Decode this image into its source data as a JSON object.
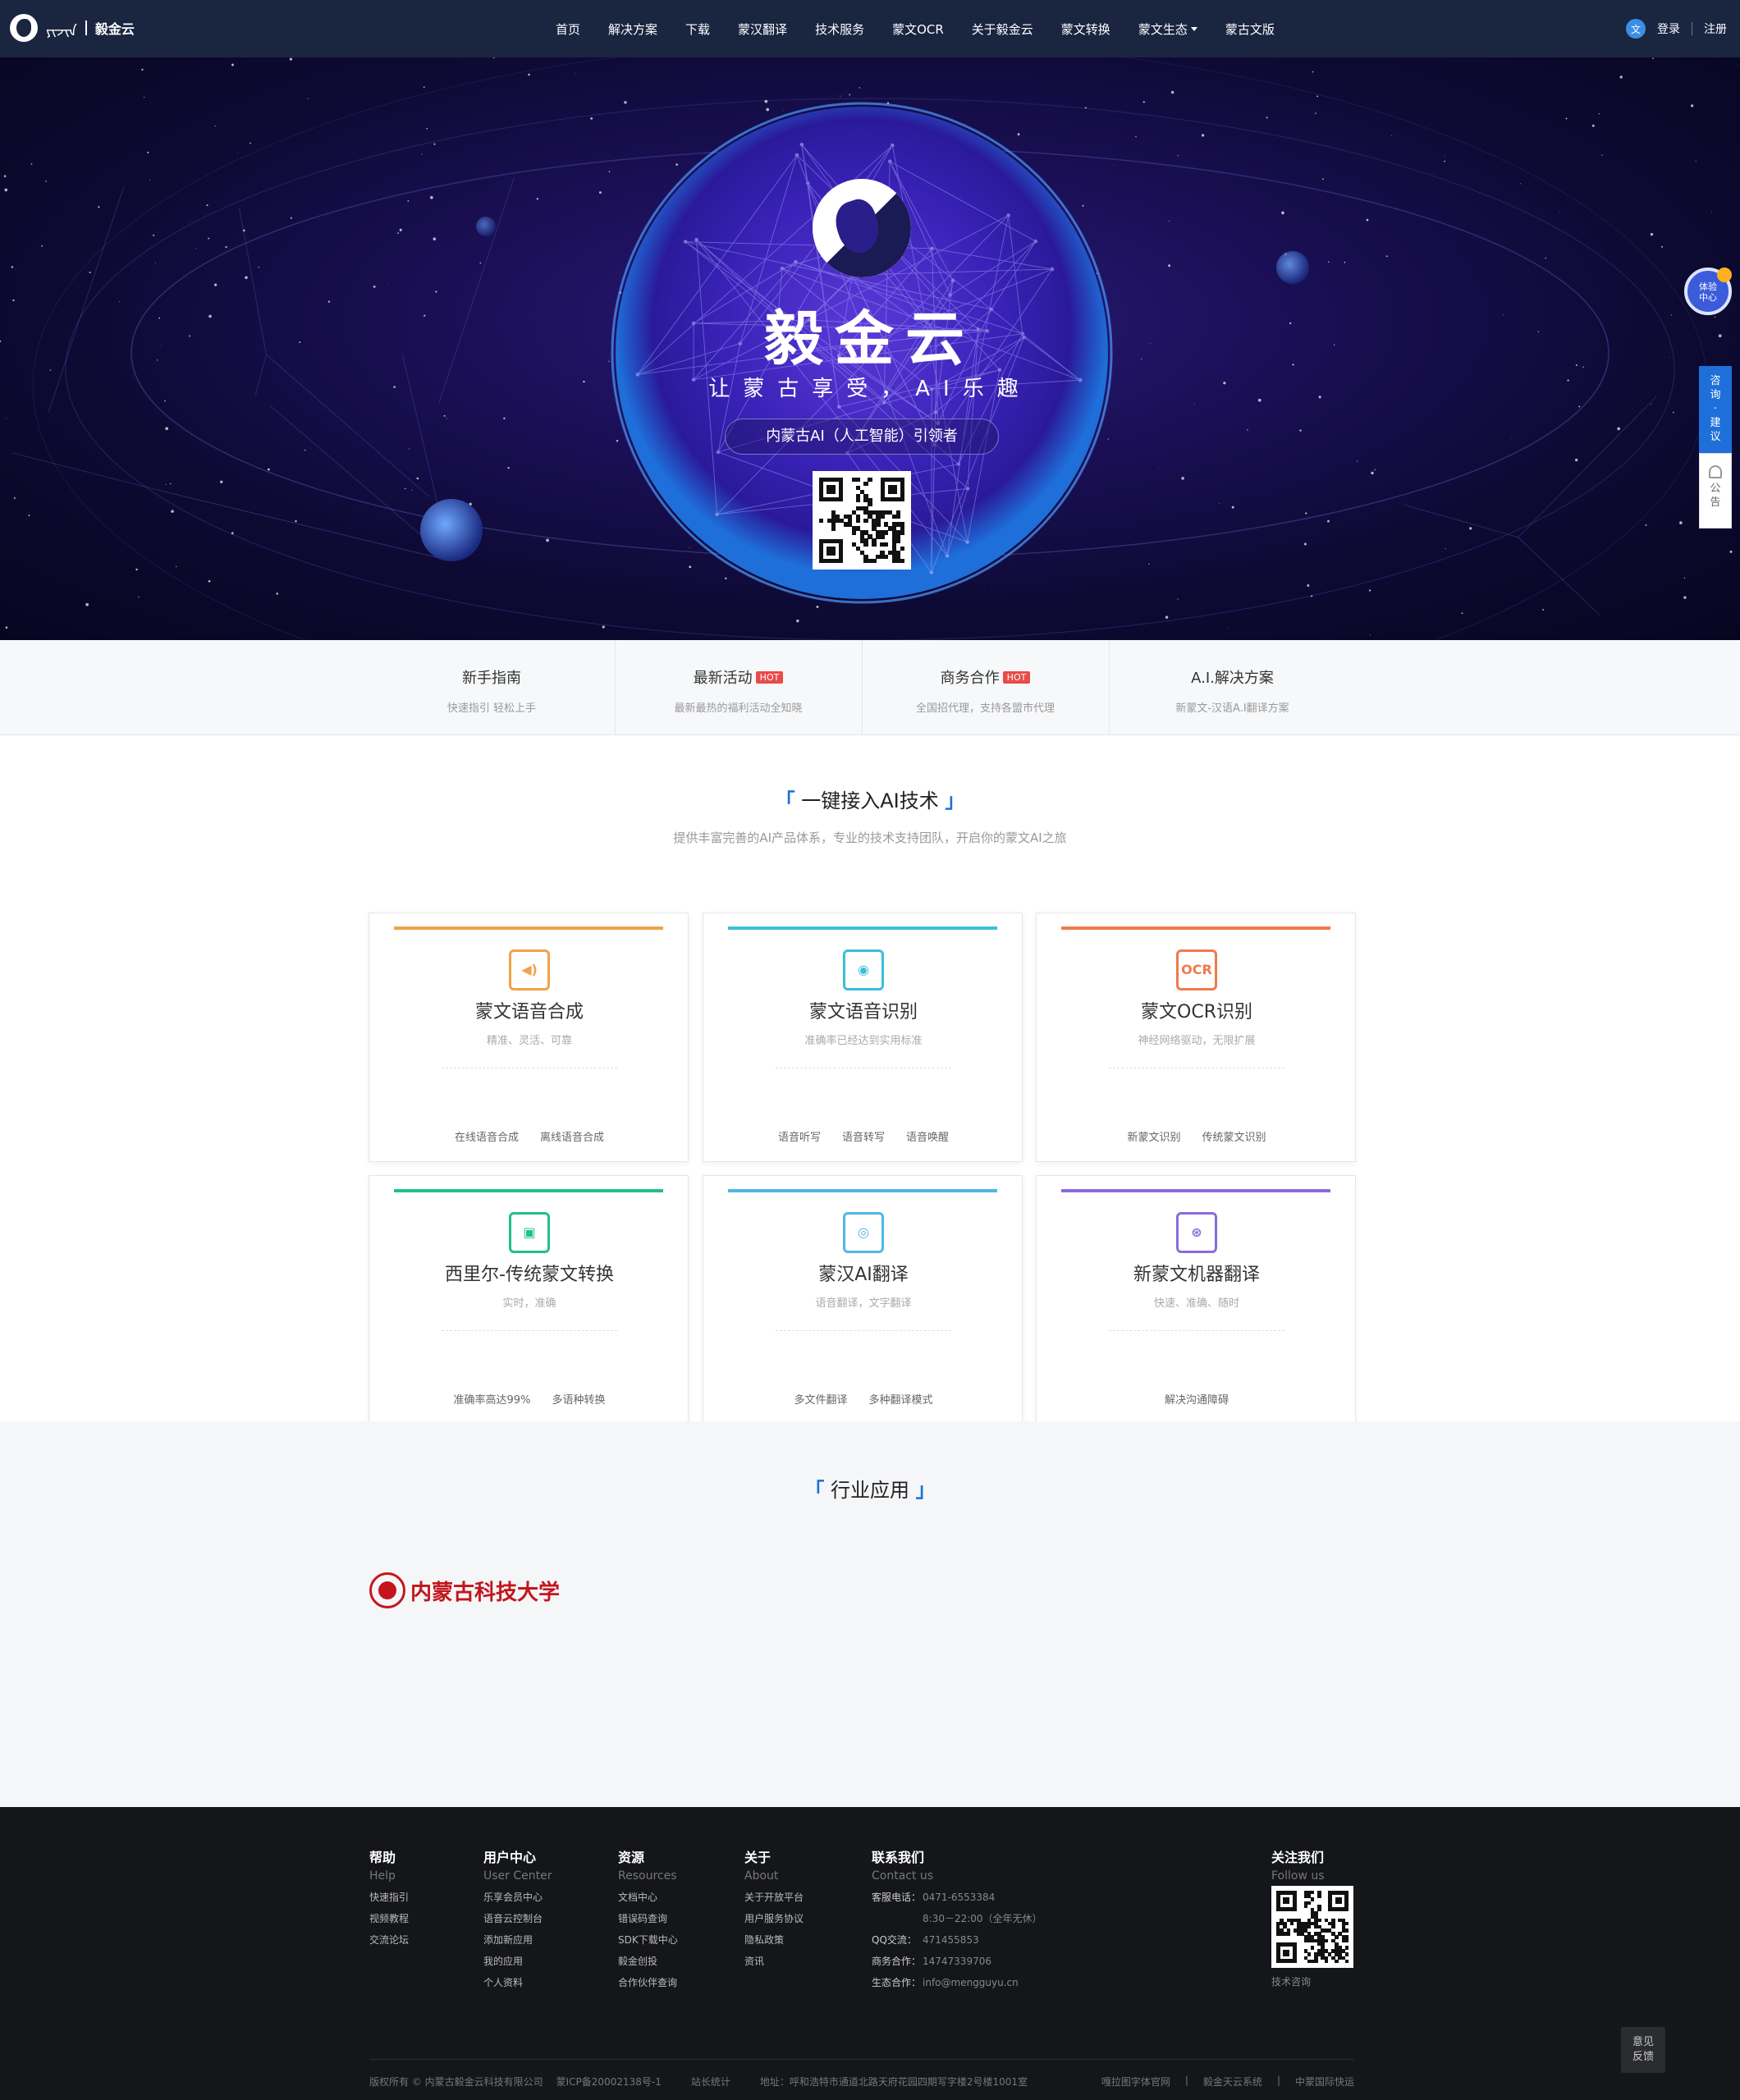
{
  "header": {
    "logo_mongol": "ᠶᠢᠵᠢᠨ",
    "brand": "毅金云",
    "nav": [
      "首页",
      "解决方案",
      "下载",
      "蒙汉翻译",
      "技术服务",
      "蒙文OCR",
      "关于毅金云",
      "蒙文转换",
      "蒙文生态",
      "蒙古文版"
    ],
    "avatar_char": "文",
    "login": "登录",
    "register": "注册"
  },
  "hero": {
    "title": "毅金云",
    "subtitle": "让蒙古享受，AI乐趣",
    "pill": "内蒙古AI（人工智能）引领者"
  },
  "side": {
    "experience": [
      "体验",
      "中心"
    ],
    "consult": "咨询·建议",
    "notice": "公告"
  },
  "quick": [
    {
      "title": "新手指南",
      "hot": "",
      "desc": "快速指引 轻松上手"
    },
    {
      "title": "最新活动",
      "hot": "HOT",
      "desc": "最新最热的福利活动全知晓"
    },
    {
      "title": "商务合作",
      "hot": "HOT",
      "desc": "全国招代理，支持各盟市代理"
    },
    {
      "title": "A.I.解决方案",
      "hot": "",
      "desc": "新蒙文-汉语A.I翻译方案"
    }
  ],
  "ai_section": {
    "title": "一键接入AI技术",
    "bracket_l": "「",
    "bracket_r": "」",
    "desc": "提供丰富完善的AI产品体系，专业的技术支持团队，开启你的蒙文AI之旅"
  },
  "cards": [
    {
      "title": "蒙文语音合成",
      "desc": "精准、灵活、可靠",
      "links": [
        "在线语音合成",
        "离线语音合成"
      ],
      "color": "#f0a24a",
      "icon": "speaker-icon",
      "glyph": "◀)"
    },
    {
      "title": "蒙文语音识别",
      "desc": "准确率已经达到实用标准",
      "links": [
        "语音听写",
        "语音转写",
        "语音唤醒"
      ],
      "color": "#3bbfd8",
      "icon": "microphone-icon",
      "glyph": "◉"
    },
    {
      "title": "蒙文OCR识别",
      "desc": "神经网络驱动，无限扩展",
      "links": [
        "新蒙文识别",
        "传统蒙文识别"
      ],
      "color": "#ee7b4c",
      "icon": "ocr-icon",
      "glyph": "OCR"
    },
    {
      "title": "西里尔-传统蒙文转换",
      "desc": "实时，准确",
      "links": [
        "准确率高达99%",
        "多语种转换"
      ],
      "color": "#1fbf8f",
      "icon": "chip-icon",
      "glyph": "▣"
    },
    {
      "title": "蒙汉AI翻译",
      "desc": "语音翻译，文字翻译",
      "links": [
        "多文件翻译",
        "多种翻译模式"
      ],
      "color": "#4fb8e0",
      "icon": "translate-icon",
      "glyph": "◎"
    },
    {
      "title": "新蒙文机器翻译",
      "desc": "快速、准确、随时",
      "links": [
        "解决沟通障碍"
      ],
      "color": "#8a6be0",
      "icon": "machine-translate-icon",
      "glyph": "⊛"
    }
  ],
  "industry": {
    "title": "行业应用",
    "partner": "内蒙古科技大学"
  },
  "footer": {
    "cols": [
      {
        "h": "帮助",
        "en": "Help",
        "links": [
          "快速指引",
          "视频教程",
          "交流论坛"
        ]
      },
      {
        "h": "用户中心",
        "en": "User Center",
        "links": [
          "乐享会员中心",
          "语音云控制台",
          "添加新应用",
          "我的应用",
          "个人资料"
        ]
      },
      {
        "h": "资源",
        "en": "Resources",
        "links": [
          "文档中心",
          "错误码查询",
          "SDK下载中心",
          "毅金创投",
          "合作伙伴查询"
        ]
      },
      {
        "h": "关于",
        "en": "About",
        "links": [
          "关于开放平台",
          "用户服务协议",
          "隐私政策",
          "资讯"
        ]
      }
    ],
    "contact": {
      "h": "联系我们",
      "en": "Contact us",
      "rows": [
        {
          "k": "客服电话：",
          "v": "0471-6553384"
        },
        {
          "k": "",
          "v": "8:30－22:00（全年无休）"
        },
        {
          "k": "QQ交流：",
          "v": "471455853"
        },
        {
          "k": "商务合作：",
          "v": "14747339706"
        },
        {
          "k": "生态合作：",
          "v": "info@mengguyu.cn"
        }
      ]
    },
    "follow": {
      "h": "关注我们",
      "en": "Follow us",
      "caption": "技术咨询"
    },
    "copyright": "版权所有 © 内蒙古毅金云科技有限公司",
    "icp": "蒙ICP备20002138号-1",
    "stats": "站长统计",
    "address": "地址：呼和浩特市通道北路天府花园四期写字楼2号楼1001室",
    "friend_links": [
      "嘎拉图字体官网",
      "毅金天云系统",
      "中蒙国际快运"
    ],
    "link_sep": "|",
    "feedback": [
      "意见",
      "反馈"
    ]
  }
}
